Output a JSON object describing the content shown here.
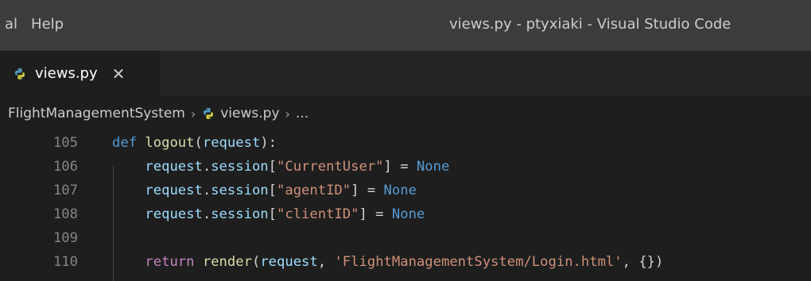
{
  "titlebar": {
    "menu": [
      "al",
      "Help"
    ],
    "window_title": "views.py - ptyxiaki - Visual Studio Code"
  },
  "tab": {
    "icon": "python-icon",
    "label": "views.py",
    "close": "✕"
  },
  "breadcrumbs": {
    "folder": "FlightManagementSystem",
    "separator": "›",
    "file": "views.py",
    "more": "..."
  },
  "editor": {
    "lines": [
      {
        "number": "105",
        "tokens": [
          {
            "t": "def",
            "c": "kw"
          },
          {
            "t": " ",
            "c": "plain"
          },
          {
            "t": "logout",
            "c": "fn"
          },
          {
            "t": "(",
            "c": "plain"
          },
          {
            "t": "request",
            "c": "var"
          },
          {
            "t": "):",
            "c": "plain"
          }
        ]
      },
      {
        "number": "106",
        "tokens": [
          {
            "t": "    ",
            "c": "plain"
          },
          {
            "t": "request",
            "c": "var"
          },
          {
            "t": ".",
            "c": "plain"
          },
          {
            "t": "session",
            "c": "var"
          },
          {
            "t": "[",
            "c": "plain"
          },
          {
            "t": "\"CurrentUser\"",
            "c": "str"
          },
          {
            "t": "] = ",
            "c": "plain"
          },
          {
            "t": "None",
            "c": "const"
          }
        ]
      },
      {
        "number": "107",
        "tokens": [
          {
            "t": "    ",
            "c": "plain"
          },
          {
            "t": "request",
            "c": "var"
          },
          {
            "t": ".",
            "c": "plain"
          },
          {
            "t": "session",
            "c": "var"
          },
          {
            "t": "[",
            "c": "plain"
          },
          {
            "t": "\"agentID\"",
            "c": "str"
          },
          {
            "t": "] = ",
            "c": "plain"
          },
          {
            "t": "None",
            "c": "const"
          }
        ]
      },
      {
        "number": "108",
        "tokens": [
          {
            "t": "    ",
            "c": "plain"
          },
          {
            "t": "request",
            "c": "var"
          },
          {
            "t": ".",
            "c": "plain"
          },
          {
            "t": "session",
            "c": "var"
          },
          {
            "t": "[",
            "c": "plain"
          },
          {
            "t": "\"clientID\"",
            "c": "str"
          },
          {
            "t": "] = ",
            "c": "plain"
          },
          {
            "t": "None",
            "c": "const"
          }
        ]
      },
      {
        "number": "109",
        "tokens": []
      },
      {
        "number": "110",
        "tokens": [
          {
            "t": "    ",
            "c": "plain"
          },
          {
            "t": "return",
            "c": "ctl"
          },
          {
            "t": " ",
            "c": "plain"
          },
          {
            "t": "render",
            "c": "fn"
          },
          {
            "t": "(",
            "c": "plain"
          },
          {
            "t": "request",
            "c": "var"
          },
          {
            "t": ", ",
            "c": "plain"
          },
          {
            "t": "'FlightManagementSystem/Login.html'",
            "c": "str"
          },
          {
            "t": ", {})",
            "c": "plain"
          }
        ]
      }
    ]
  }
}
